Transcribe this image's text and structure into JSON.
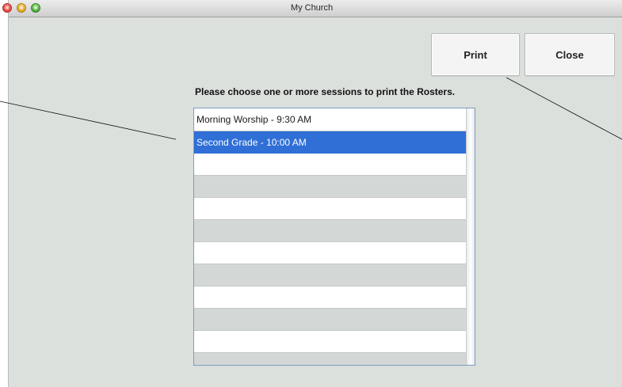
{
  "window": {
    "title": "My Church"
  },
  "toolbar": {
    "print_label": "Print",
    "close_label": "Close"
  },
  "instruction": "Please choose one or more sessions to print the Rosters.",
  "sessions": [
    {
      "label": "Morning Worship - 9:30 AM",
      "selected": false
    },
    {
      "label": "Second Grade - 10:00 AM",
      "selected": true
    },
    {
      "label": "",
      "selected": false
    },
    {
      "label": "",
      "selected": false
    },
    {
      "label": "",
      "selected": false
    },
    {
      "label": "",
      "selected": false
    },
    {
      "label": "",
      "selected": false
    },
    {
      "label": "",
      "selected": false
    },
    {
      "label": "",
      "selected": false
    },
    {
      "label": "",
      "selected": false
    },
    {
      "label": "",
      "selected": false
    },
    {
      "label": "",
      "selected": false
    }
  ],
  "colors": {
    "selection": "#2f6fd6",
    "window_background": "#dbe0dd"
  }
}
